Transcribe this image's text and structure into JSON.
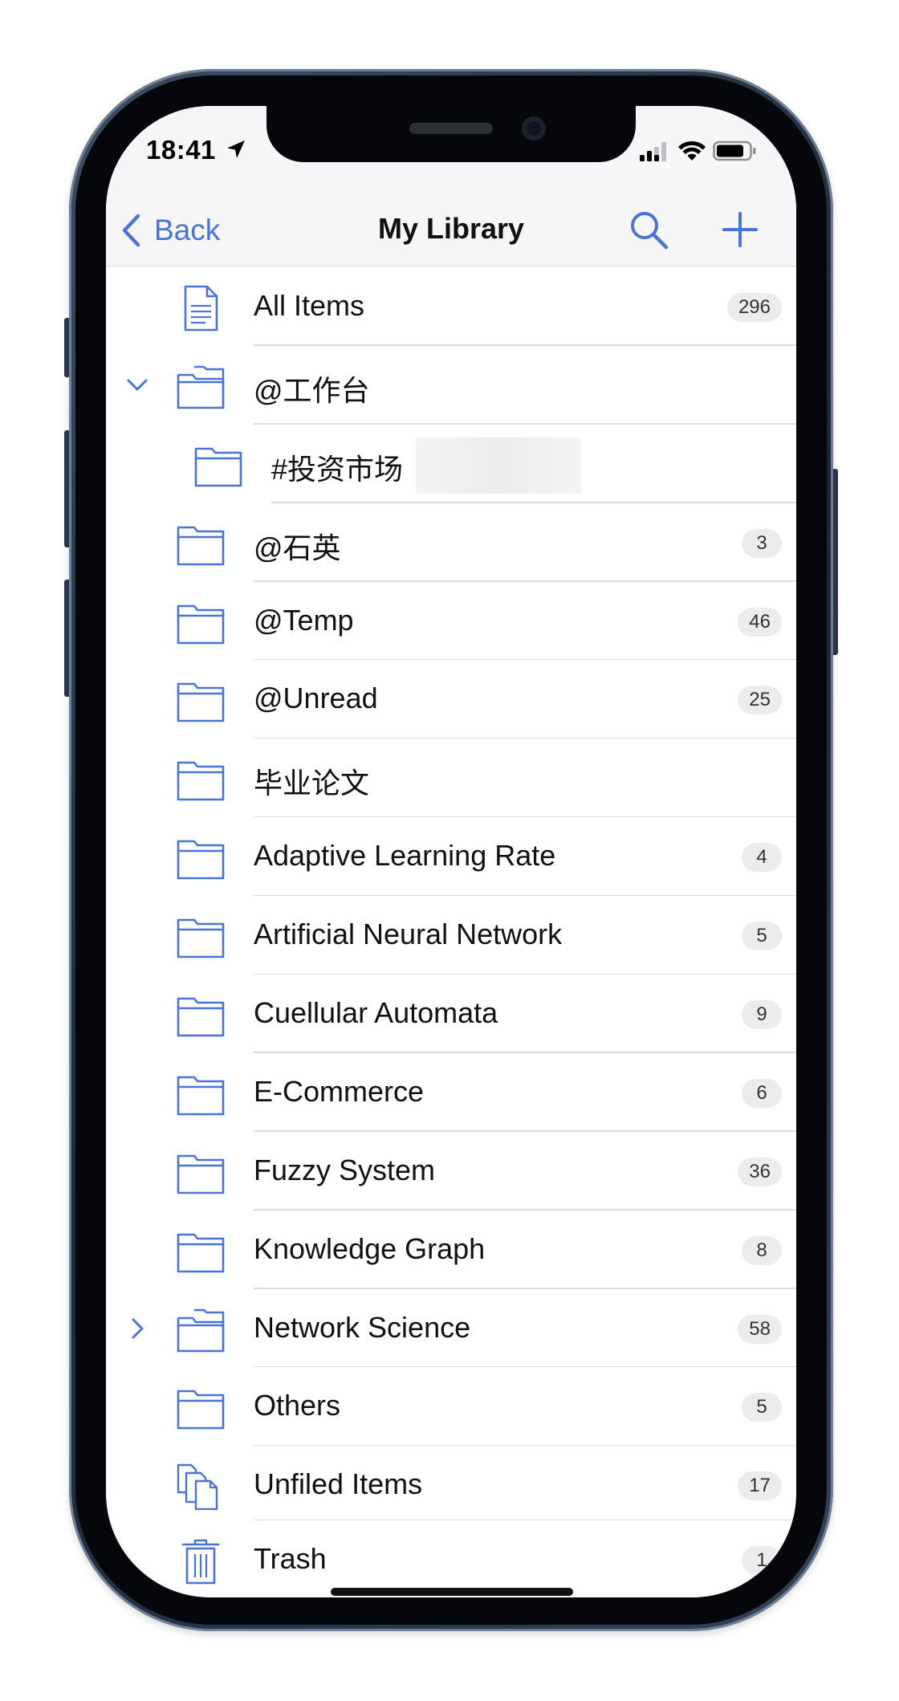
{
  "status_bar": {
    "time": "18:41"
  },
  "nav": {
    "back_label": "Back",
    "title": "My Library"
  },
  "colors": {
    "accent": "#4a73d6",
    "badge_bg": "#ececef",
    "nav_bg": "#f6f6f8"
  },
  "list": {
    "items": [
      {
        "label": "All Items",
        "count": "296",
        "icon": "document-icon"
      },
      {
        "label": "@工作台",
        "count": "",
        "icon": "folder-stack-icon",
        "disclosure": "expanded"
      },
      {
        "label": "#投资市场",
        "count": "",
        "icon": "folder-icon",
        "child": true
      },
      {
        "label": "@石英",
        "count": "3",
        "icon": "folder-icon"
      },
      {
        "label": "@Temp",
        "count": "46",
        "icon": "folder-icon"
      },
      {
        "label": "@Unread",
        "count": "25",
        "icon": "folder-icon"
      },
      {
        "label": "毕业论文",
        "count": "",
        "icon": "folder-icon"
      },
      {
        "label": "Adaptive Learning Rate",
        "count": "4",
        "icon": "folder-icon"
      },
      {
        "label": "Artificial Neural Network",
        "count": "5",
        "icon": "folder-icon"
      },
      {
        "label": "Cuellular Automata",
        "count": "9",
        "icon": "folder-icon"
      },
      {
        "label": "E-Commerce",
        "count": "6",
        "icon": "folder-icon"
      },
      {
        "label": "Fuzzy System",
        "count": "36",
        "icon": "folder-icon"
      },
      {
        "label": "Knowledge Graph",
        "count": "8",
        "icon": "folder-icon"
      },
      {
        "label": "Network Science",
        "count": "58",
        "icon": "folder-stack-icon",
        "disclosure": "collapsed"
      },
      {
        "label": "Others",
        "count": "5",
        "icon": "folder-icon"
      },
      {
        "label": "Unfiled Items",
        "count": "17",
        "icon": "unfiled-documents-icon"
      },
      {
        "label": "Trash",
        "count": "1",
        "icon": "trash-icon"
      }
    ]
  }
}
